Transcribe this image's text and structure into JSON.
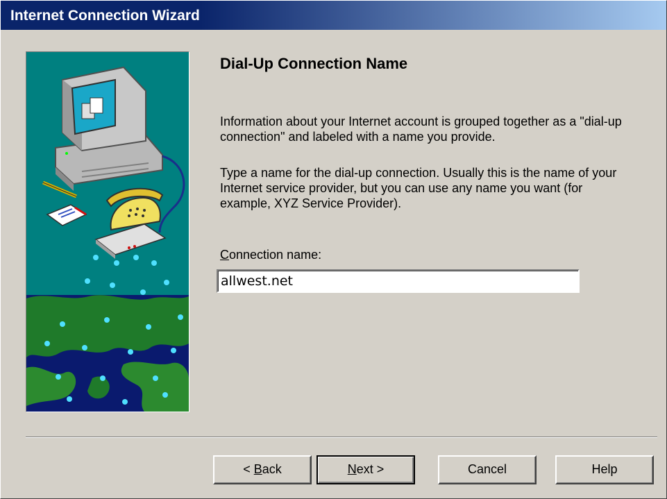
{
  "window": {
    "title": "Internet Connection Wizard"
  },
  "page": {
    "heading": "Dial-Up Connection Name",
    "paragraph1": "Information about your Internet account is grouped together as a \"dial-up connection\" and labeled with a name you provide.",
    "paragraph2": "Type a name for the dial-up connection. Usually this is the name of your Internet service provider, but you can use any name you want (for example, XYZ Service Provider).",
    "field_label_mnemonic": "C",
    "field_label_rest": "onnection name:",
    "connection_name_value": "allwest.net"
  },
  "buttons": {
    "back_prefix": "< ",
    "back_mnemonic": "B",
    "back_rest": "ack",
    "next_mnemonic": "N",
    "next_rest": "ext >",
    "cancel": "Cancel",
    "help": "Help"
  },
  "colors": {
    "titlebar_start": "#0a246a",
    "titlebar_end": "#a6caf0",
    "dialog_face": "#d4d0c8",
    "art_background": "#008080"
  },
  "icons": [
    "computer-icon",
    "telephone-icon",
    "pencil-icon",
    "notepad-icon",
    "globe-network-icon"
  ]
}
